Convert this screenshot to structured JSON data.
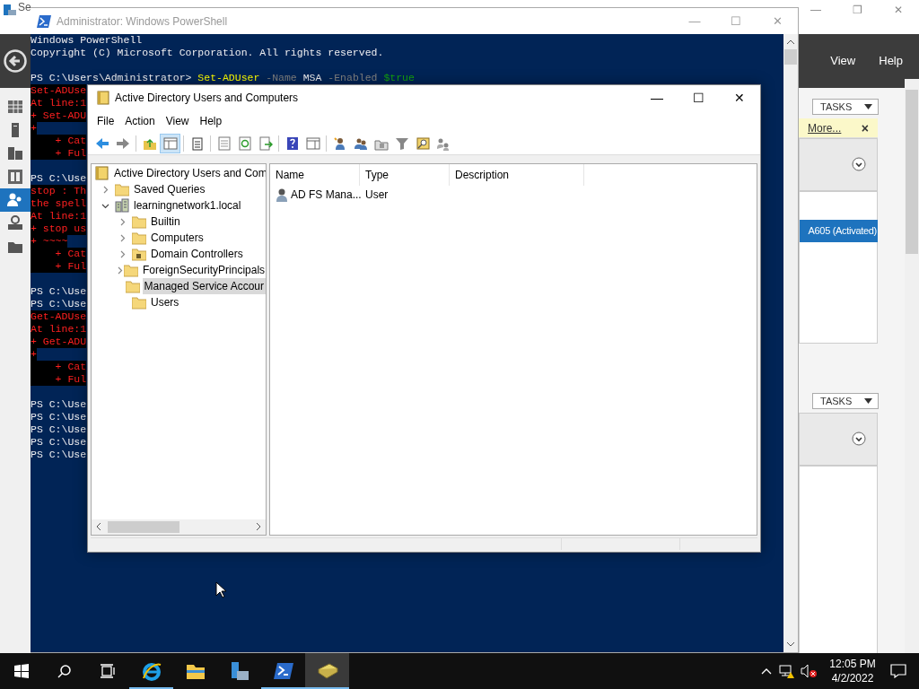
{
  "server_manager": {
    "title": "Se",
    "window_controls": [
      "—",
      "❐",
      "✕"
    ],
    "menu": [
      "View",
      "Help"
    ],
    "nav": [
      {
        "kind": "dashboard",
        "selected": false
      },
      {
        "kind": "server",
        "selected": false
      },
      {
        "kind": "servers",
        "selected": false
      },
      {
        "kind": "roles",
        "selected": false
      },
      {
        "kind": "users",
        "selected": true
      },
      {
        "kind": "network",
        "selected": false
      },
      {
        "kind": "files",
        "selected": false
      }
    ],
    "tiles": [
      {
        "tasks": "TASKS",
        "notice": {
          "link": "More...",
          "close": "×"
        },
        "rows": [
          {
            "text": "A605 (Activated)",
            "selected": true
          }
        ]
      },
      {
        "tasks": "TASKS"
      }
    ]
  },
  "powershell": {
    "title": "Administrator: Windows PowerShell",
    "window_controls": [
      "—",
      "☐",
      "✕"
    ],
    "lines": [
      {
        "kind": "plain",
        "text": "Windows PowerShell"
      },
      {
        "kind": "plain",
        "text": "Copyright (C) Microsoft Corporation. All rights reserved."
      },
      {
        "kind": "blank"
      },
      {
        "kind": "command",
        "segments": [
          {
            "kind": "plain",
            "text": "PS C:\\Users\\Administrator> "
          },
          {
            "kind": "cmdlet",
            "text": "Set-ADUser"
          },
          {
            "kind": "param",
            "text": " -Name"
          },
          {
            "kind": "plain",
            "text": " MSA"
          },
          {
            "kind": "param",
            "text": " -Enabled"
          },
          {
            "kind": "variable",
            "text": " $true"
          }
        ]
      },
      {
        "kind": "error",
        "text": "Set-ADUse"
      },
      {
        "kind": "error",
        "text": "At line:1"
      },
      {
        "kind": "error",
        "text": "+ Set-ADU"
      },
      {
        "kind": "error",
        "text": "+"
      },
      {
        "kind": "error",
        "text": "    + Cat"
      },
      {
        "kind": "error",
        "text": "    + Ful"
      },
      {
        "kind": "blank"
      },
      {
        "kind": "plain",
        "text": "PS C:\\Use"
      },
      {
        "kind": "error",
        "text": "stop : Th"
      },
      {
        "kind": "error",
        "text": "the spell"
      },
      {
        "kind": "error",
        "text": "At line:1"
      },
      {
        "kind": "error",
        "text": "+ stop us"
      },
      {
        "kind": "error",
        "text": "+ ~~~~"
      },
      {
        "kind": "error",
        "text": "    + Cat"
      },
      {
        "kind": "error",
        "text": "    + Ful"
      },
      {
        "kind": "blank"
      },
      {
        "kind": "plain",
        "text": "PS C:\\Use"
      },
      {
        "kind": "plain",
        "text": "PS C:\\Use"
      },
      {
        "kind": "error",
        "text": "Get-ADUse"
      },
      {
        "kind": "error",
        "text": "At line:1"
      },
      {
        "kind": "error",
        "text": "+ Get-ADU"
      },
      {
        "kind": "error",
        "text": "+"
      },
      {
        "kind": "error",
        "text": "    + Cat"
      },
      {
        "kind": "error",
        "text": "    + Ful"
      },
      {
        "kind": "blank"
      },
      {
        "kind": "plain",
        "text": "PS C:\\Use"
      },
      {
        "kind": "plain",
        "text": "PS C:\\Use"
      },
      {
        "kind": "plain",
        "text": "PS C:\\Use"
      },
      {
        "kind": "plain",
        "text": "PS C:\\Use"
      },
      {
        "kind": "plain",
        "text": "PS C:\\Use"
      }
    ]
  },
  "aduc": {
    "title": "Active Directory Users and Computers",
    "window_controls": [
      "—",
      "☐",
      "✕"
    ],
    "menu": [
      "File",
      "Action",
      "View",
      "Help"
    ],
    "toolbar": [
      {
        "kind": "back",
        "pressed": false
      },
      {
        "kind": "forward",
        "pressed": false
      },
      {
        "kind": "sep"
      },
      {
        "kind": "up",
        "pressed": false
      },
      {
        "kind": "tree",
        "pressed": true
      },
      {
        "kind": "sep"
      },
      {
        "kind": "clipboard",
        "pressed": false
      },
      {
        "kind": "sep"
      },
      {
        "kind": "properties",
        "pressed": false
      },
      {
        "kind": "refresh",
        "pressed": false
      },
      {
        "kind": "export",
        "pressed": false
      },
      {
        "kind": "sep"
      },
      {
        "kind": "help",
        "pressed": false
      },
      {
        "kind": "console",
        "pressed": false
      },
      {
        "kind": "sep"
      },
      {
        "kind": "user",
        "pressed": false
      },
      {
        "kind": "group",
        "pressed": false
      },
      {
        "kind": "ou",
        "pressed": false
      },
      {
        "kind": "filter",
        "pressed": false
      },
      {
        "kind": "find",
        "pressed": false
      },
      {
        "kind": "add",
        "pressed": false
      }
    ],
    "tree": [
      {
        "label": "Active Directory Users and Com",
        "kind": "root",
        "selected": false,
        "children": [
          {
            "label": "Saved Queries",
            "kind": "folder",
            "expanded": false,
            "selected": false
          },
          {
            "label": "learningnetwork1.local",
            "kind": "domain",
            "expanded": true,
            "selected": false,
            "children": [
              {
                "label": "Builtin",
                "kind": "folder",
                "expanded": false,
                "selected": false
              },
              {
                "label": "Computers",
                "kind": "folder",
                "expanded": false,
                "selected": false
              },
              {
                "label": "Domain Controllers",
                "kind": "dc",
                "expanded": false,
                "selected": false
              },
              {
                "label": "ForeignSecurityPrincipals",
                "kind": "folder",
                "expanded": false,
                "selected": false
              },
              {
                "label": "Managed Service Accour",
                "kind": "folder",
                "selected": true
              },
              {
                "label": "Users",
                "kind": "folder",
                "selected": false
              }
            ]
          }
        ]
      }
    ],
    "columns": [
      "Name",
      "Type",
      "Description"
    ],
    "rows": [
      {
        "name": "AD FS Mana...",
        "type": "User"
      }
    ]
  },
  "taskbar": {
    "apps": [
      {
        "kind": "ie",
        "running": true,
        "active": false
      },
      {
        "kind": "explorer",
        "running": false,
        "active": false
      },
      {
        "kind": "servermanager",
        "running": false,
        "active": false
      },
      {
        "kind": "powershell",
        "running": true,
        "active": false
      },
      {
        "kind": "aduc",
        "running": true,
        "active": true
      }
    ],
    "time": "12:05 PM",
    "date": "4/2/2022"
  }
}
